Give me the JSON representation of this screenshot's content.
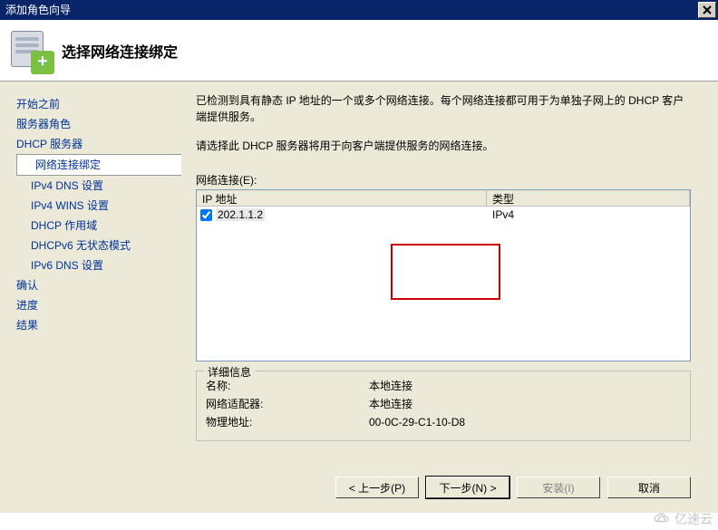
{
  "titlebar": {
    "title": "添加角色向导"
  },
  "header": {
    "title": "选择网络连接绑定"
  },
  "sidebar": {
    "items": [
      {
        "label": "开始之前"
      },
      {
        "label": "服务器角色"
      },
      {
        "label": "DHCP 服务器"
      },
      {
        "label": "网络连接绑定",
        "child": true,
        "active": true
      },
      {
        "label": "IPv4 DNS 设置",
        "child": true
      },
      {
        "label": "IPv4 WINS 设置",
        "child": true
      },
      {
        "label": "DHCP 作用域",
        "child": true
      },
      {
        "label": "DHCPv6 无状态模式",
        "child": true
      },
      {
        "label": "IPv6 DNS 设置",
        "child": true
      },
      {
        "label": "确认"
      },
      {
        "label": "进度"
      },
      {
        "label": "结果"
      }
    ]
  },
  "main": {
    "desc1": "已检测到具有静态 IP 地址的一个或多个网络连接。每个网络连接都可用于为单独子网上的 DHCP 客户端提供服务。",
    "desc2": "请选择此 DHCP 服务器将用于向客户端提供服务的网络连接。",
    "list_label": "网络连接(E):",
    "columns": {
      "ip": "IP 地址",
      "type": "类型"
    },
    "rows": [
      {
        "checked": true,
        "ip": "202.1.1.2",
        "type": "IPv4"
      }
    ],
    "details": {
      "legend": "详细信息",
      "rows": [
        {
          "k": "名称:",
          "v": "本地连接"
        },
        {
          "k": "网络适配器:",
          "v": "本地连接"
        },
        {
          "k": "物理地址:",
          "v": "00-0C-29-C1-10-D8"
        }
      ]
    }
  },
  "footer": {
    "prev": "< 上一步(P)",
    "next": "下一步(N) >",
    "install": "安装(I)",
    "cancel": "取消"
  },
  "watermark": "亿速云"
}
